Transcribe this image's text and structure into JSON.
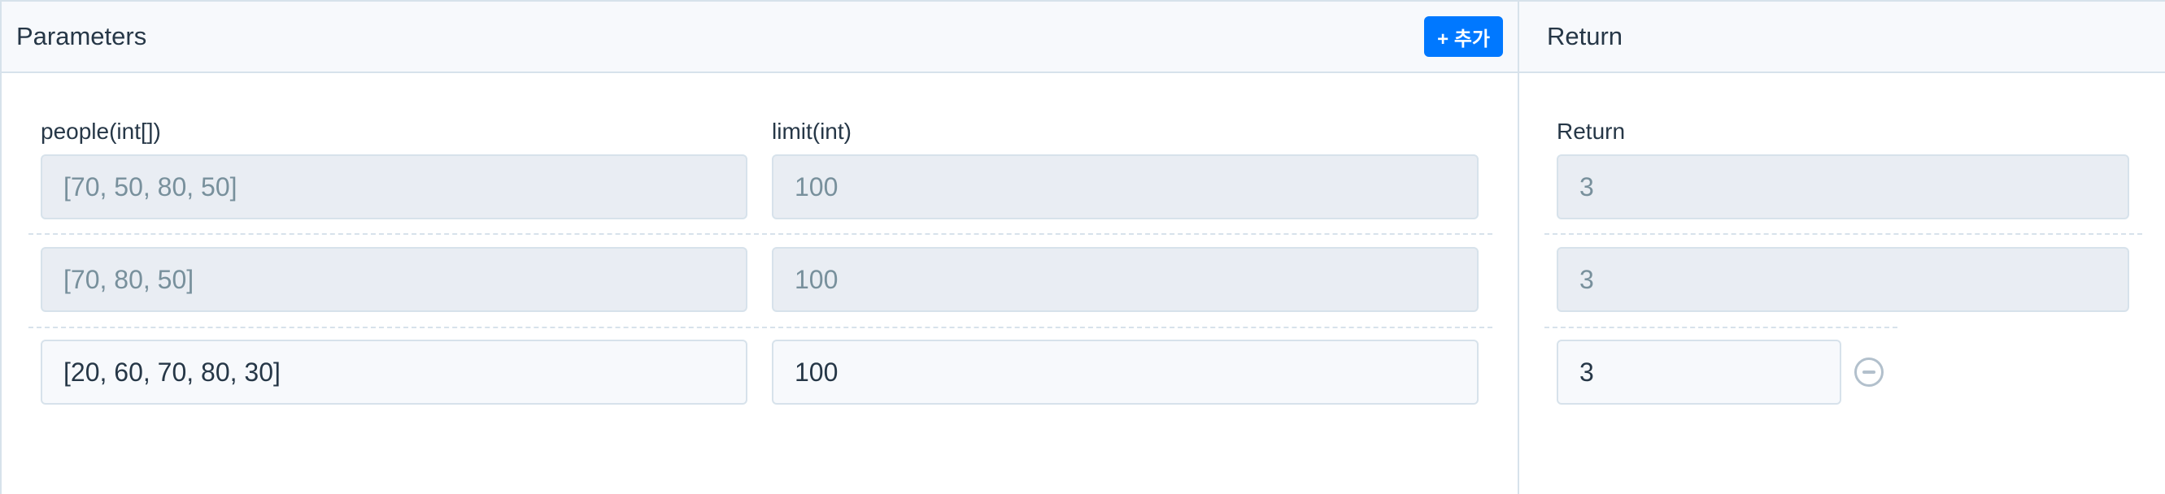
{
  "parameters": {
    "title": "Parameters",
    "add_button_label": "+ 추가",
    "columns": [
      {
        "label": "people(int[])"
      },
      {
        "label": "limit(int)"
      }
    ],
    "rows": [
      {
        "people": "[70, 50, 80, 50]",
        "limit": "100",
        "editable": false
      },
      {
        "people": "[70, 80, 50]",
        "limit": "100",
        "editable": false
      },
      {
        "people": "[20, 60, 70, 80, 30]",
        "limit": "100",
        "editable": true
      }
    ]
  },
  "returns": {
    "title": "Return",
    "column_label": "Return",
    "rows": [
      {
        "value": "3",
        "editable": false
      },
      {
        "value": "3",
        "editable": false
      },
      {
        "value": "3",
        "editable": true
      }
    ],
    "remove_icon": "minus-circle-icon"
  },
  "colors": {
    "accent": "#0078ff",
    "border": "#d7e2eb",
    "readonly_bg": "#e9edf3",
    "editable_bg": "#f7f9fc"
  }
}
